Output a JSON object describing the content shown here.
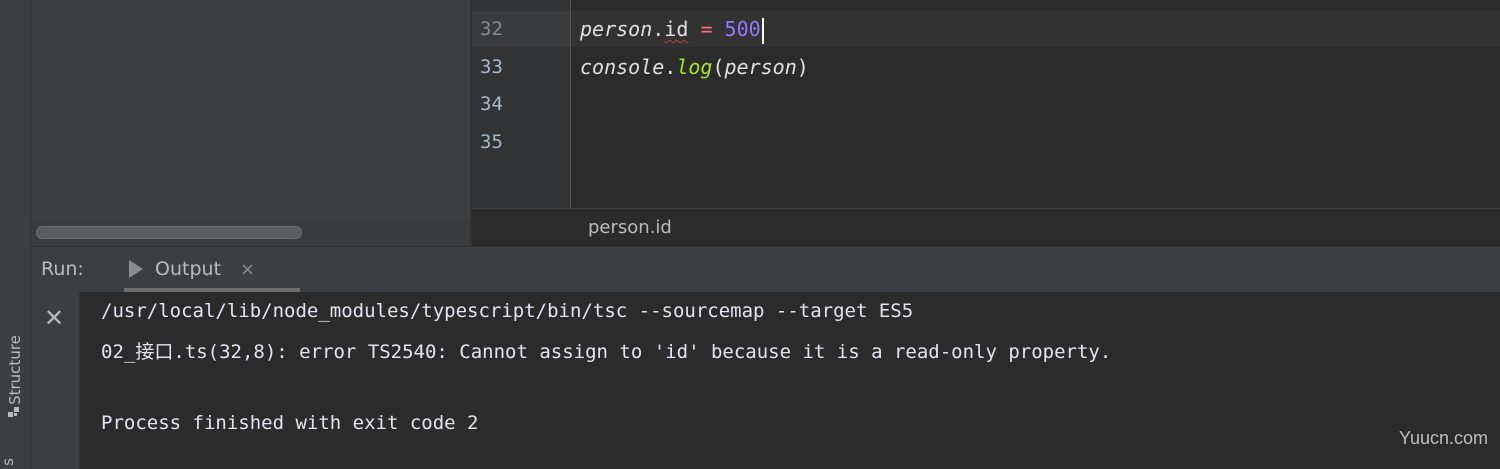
{
  "editor": {
    "line_numbers": [
      "32",
      "33",
      "34",
      "35"
    ],
    "line32": {
      "obj": "person",
      "dot": ".",
      "prop": "id",
      "op": "=",
      "value": "500"
    },
    "line33": {
      "obj": "console",
      "dot": ".",
      "fn": "log",
      "open": "(",
      "arg": "person",
      "close": ")"
    }
  },
  "breadcrumb": "person.id",
  "run_panel": {
    "label": "Run:",
    "tab_title": "Output",
    "tab_close": "×",
    "stop_glyph": "✕"
  },
  "console_lines": [
    "/usr/local/lib/node_modules/typescript/bin/tsc --sourcemap --target ES5",
    "02_接口.ts(32,8): error TS2540: Cannot assign to 'id' because it is a read-only property.",
    "Process finished with exit code 2"
  ],
  "left_strip": {
    "structure_label": "Structure",
    "bottom_glyph": "s"
  },
  "icons": {
    "run": "play-icon",
    "close": "close-icon",
    "stop": "stop-icon",
    "structure": "structure-icon"
  },
  "watermark": "Yuucn.com",
  "colors": {
    "background": "#2b2b2b",
    "panel": "#3c3f41",
    "number": "#9876ff",
    "function": "#a6e22e",
    "operator": "#ff6b81"
  }
}
